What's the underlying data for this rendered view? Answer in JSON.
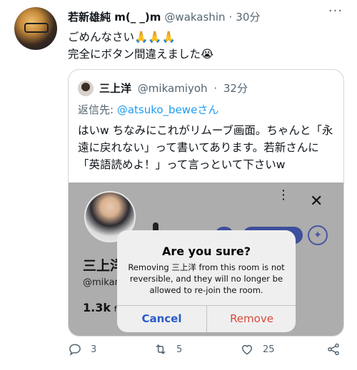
{
  "tweet": {
    "author_name": "若新雄純 m(_ _)m",
    "handle": "@wakashin",
    "separator": "·",
    "time": "30分",
    "line1": "ごめんなさい🙏🙏🙏",
    "line2": "完全にボタン間違えました😭",
    "more_glyph": "···"
  },
  "quote": {
    "author_name": "三上洋",
    "handle": "@mikamiyoh",
    "separator": "·",
    "time": "32分",
    "reply_prefix": "返信先: ",
    "reply_mention": "@atsuko_bewe",
    "reply_suffix": "さん",
    "text": "はいw ちなみにこれがリムーブ画面。ちゃんと「永遠に戻れない」って書いてあります。若新さんに「英語読めよ！」って言っといて下さいw"
  },
  "screenshot": {
    "profile_name": "三上洋",
    "profile_handle": "@mikam",
    "followers_count": "1.3k",
    "followers_suffix": "fo",
    "dots_glyph": "⋮",
    "close_glyph": "✕",
    "sparkle_glyph": "✦",
    "dialog": {
      "title": "Are you sure?",
      "message": "Removing 三上洋 from this room is not reversible, and they will no longer be allowed to re-join the room.",
      "cancel_label": "Cancel",
      "remove_label": "Remove"
    }
  },
  "actions": {
    "reply_count": "3",
    "retweet_count": "5",
    "like_count": "25",
    "icons": [
      "reply-icon",
      "retweet-icon",
      "like-icon",
      "share-icon"
    ]
  },
  "colors": {
    "accent": "#1d9bf0",
    "secondary_text": "#536471",
    "cancel_blue": "#2a5ac8",
    "remove_red": "#d9483b"
  }
}
